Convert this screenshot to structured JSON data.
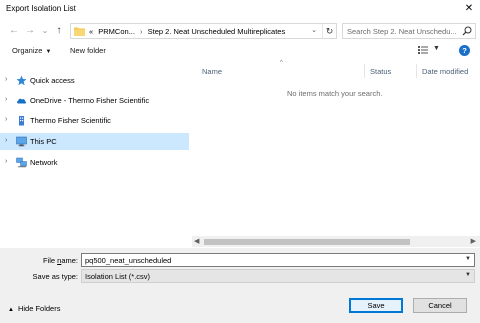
{
  "window": {
    "title": "Export Isolation List",
    "close_glyph": "✕"
  },
  "nav": {
    "back": "←",
    "forward": "→",
    "recent": "⌄",
    "up": "↑"
  },
  "address": {
    "prefix": "«",
    "crumbs": [
      "PRMCon...",
      "Step 2. Neat Unscheduled Multireplicates"
    ],
    "separator": "›",
    "dropdown": "⌄",
    "refresh": "↻"
  },
  "search": {
    "placeholder": "Search Step 2. Neat Unschedu..."
  },
  "toolbar": {
    "organize": "Organize",
    "new_folder": "New folder",
    "help": "?"
  },
  "sidebar": {
    "items": [
      {
        "label": "Quick access",
        "icon": "star-icon"
      },
      {
        "label": "OneDrive - Thermo Fisher Scientific",
        "icon": "cloud-icon"
      },
      {
        "label": "Thermo Fisher Scientific",
        "icon": "building-icon"
      },
      {
        "label": "This PC",
        "icon": "computer-icon",
        "selected": true
      },
      {
        "label": "Network",
        "icon": "network-icon"
      }
    ]
  },
  "files": {
    "columns": {
      "name": "Name",
      "status": "Status",
      "date": "Date modified"
    },
    "empty_message": "No items match your search."
  },
  "form": {
    "filename_label": "File name:",
    "filename_underline": "n",
    "filename_value": "pq500_neat_unscheduled",
    "type_label": "Save as type:",
    "type_value": "Isolation List (*.csv)"
  },
  "footer": {
    "hide_folders": "Hide Folders",
    "save": "Save",
    "cancel": "Cancel"
  },
  "colors": {
    "accent": "#0078d7",
    "selected_bg": "#cce8ff",
    "help_bg": "#1a6fc9"
  }
}
